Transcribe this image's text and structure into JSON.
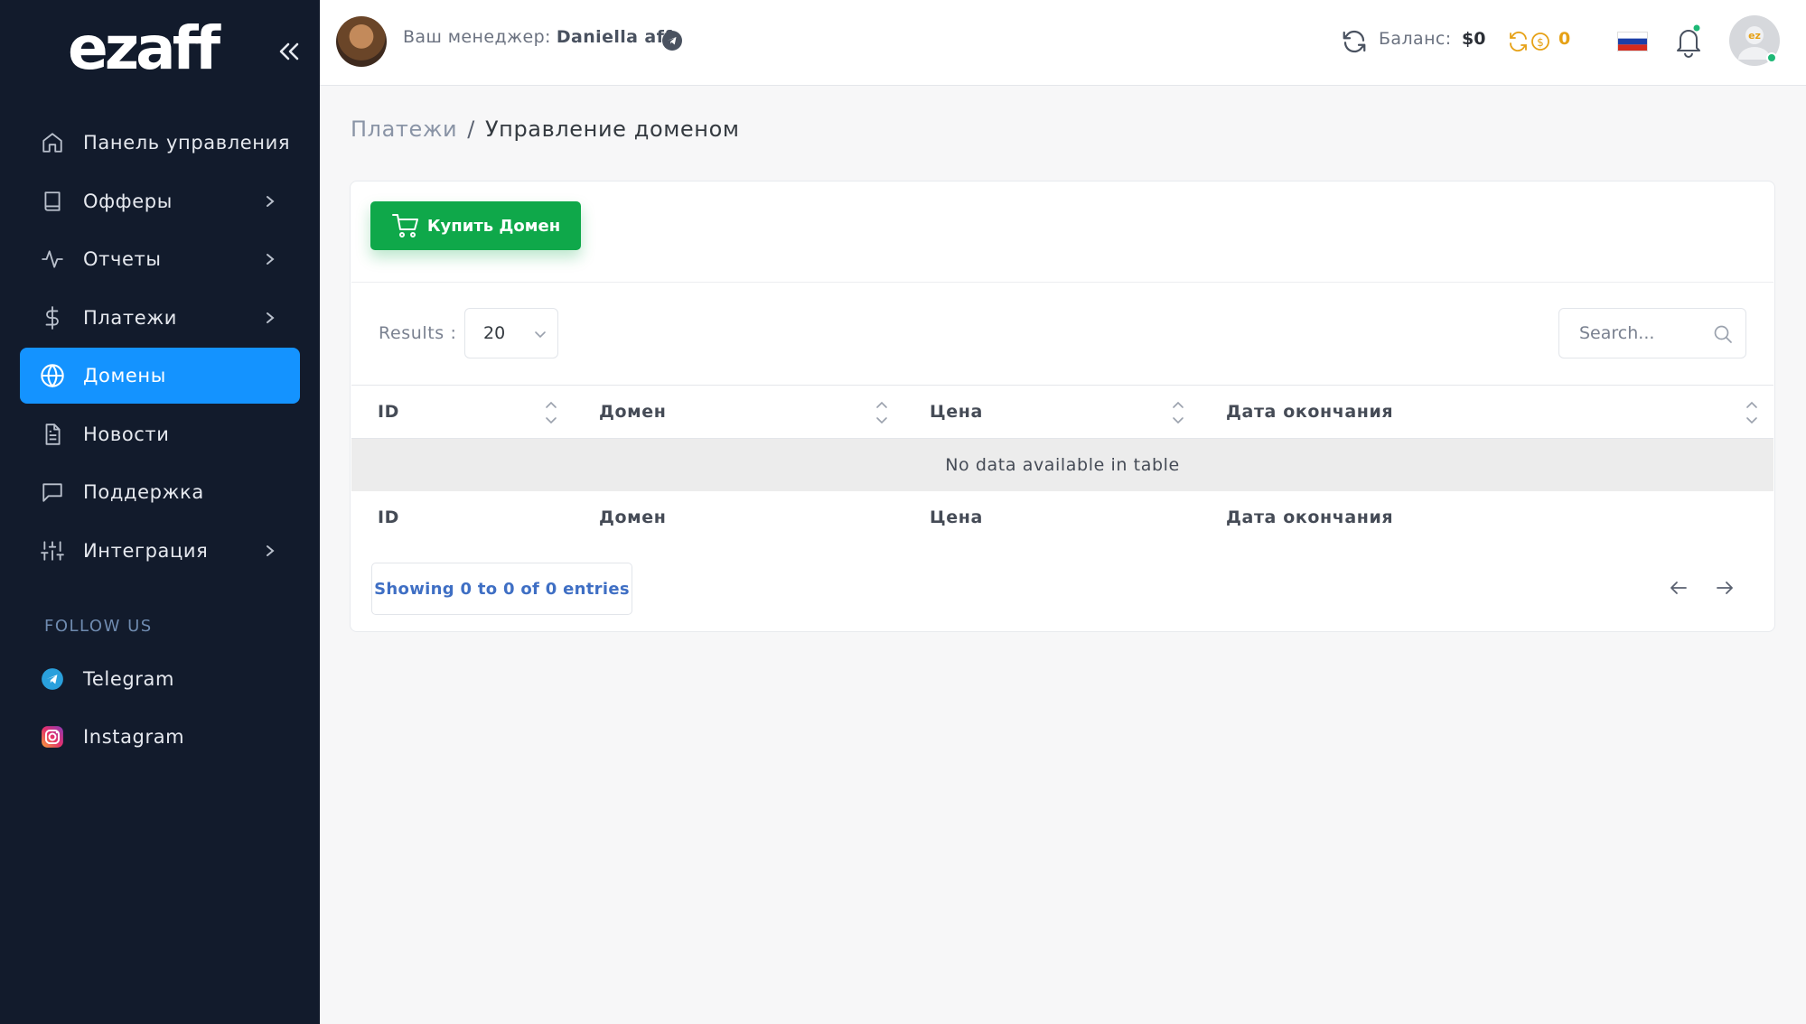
{
  "brand": {
    "logo_text": "ezaff"
  },
  "sidebar": {
    "items": [
      {
        "label": "Панель управления",
        "icon": "home-icon"
      },
      {
        "label": "Офферы",
        "icon": "book-icon"
      },
      {
        "label": "Отчеты",
        "icon": "activity-icon"
      },
      {
        "label": "Платежи",
        "icon": "dollar-icon"
      },
      {
        "label": "Домены",
        "icon": "globe-icon"
      },
      {
        "label": "Новости",
        "icon": "file-text-icon"
      },
      {
        "label": "Поддержка",
        "icon": "message-icon"
      },
      {
        "label": "Интеграция",
        "icon": "sliders-icon"
      }
    ],
    "active_index": 4,
    "follow_title": "FOLLOW US",
    "social": [
      {
        "label": "Telegram",
        "icon": "telegram-icon"
      },
      {
        "label": "Instagram",
        "icon": "instagram-icon"
      }
    ]
  },
  "topbar": {
    "manager_label": "Ваш менеджер:",
    "manager_name": "Daniella aff",
    "balance_label": "Баланс:",
    "balance_value": "$0",
    "coins_value": "0"
  },
  "breadcrumb": {
    "parent": "Платежи",
    "separator": "/",
    "current": "Управление доменом"
  },
  "actions": {
    "buy_domain": "Купить Домен"
  },
  "table_controls": {
    "results_label": "Results :",
    "results_value": "20",
    "search_placeholder": "Search..."
  },
  "table": {
    "columns": [
      "ID",
      "Домен",
      "Цена",
      "Дата окончания"
    ],
    "empty_text": "No data available in table",
    "info": "Showing 0 to 0 of 0 entries"
  },
  "colors": {
    "sidebar_bg": "#121b2c",
    "accent": "#1493ff",
    "buy_button": "#0fa84a",
    "coin": "#e6a116"
  }
}
